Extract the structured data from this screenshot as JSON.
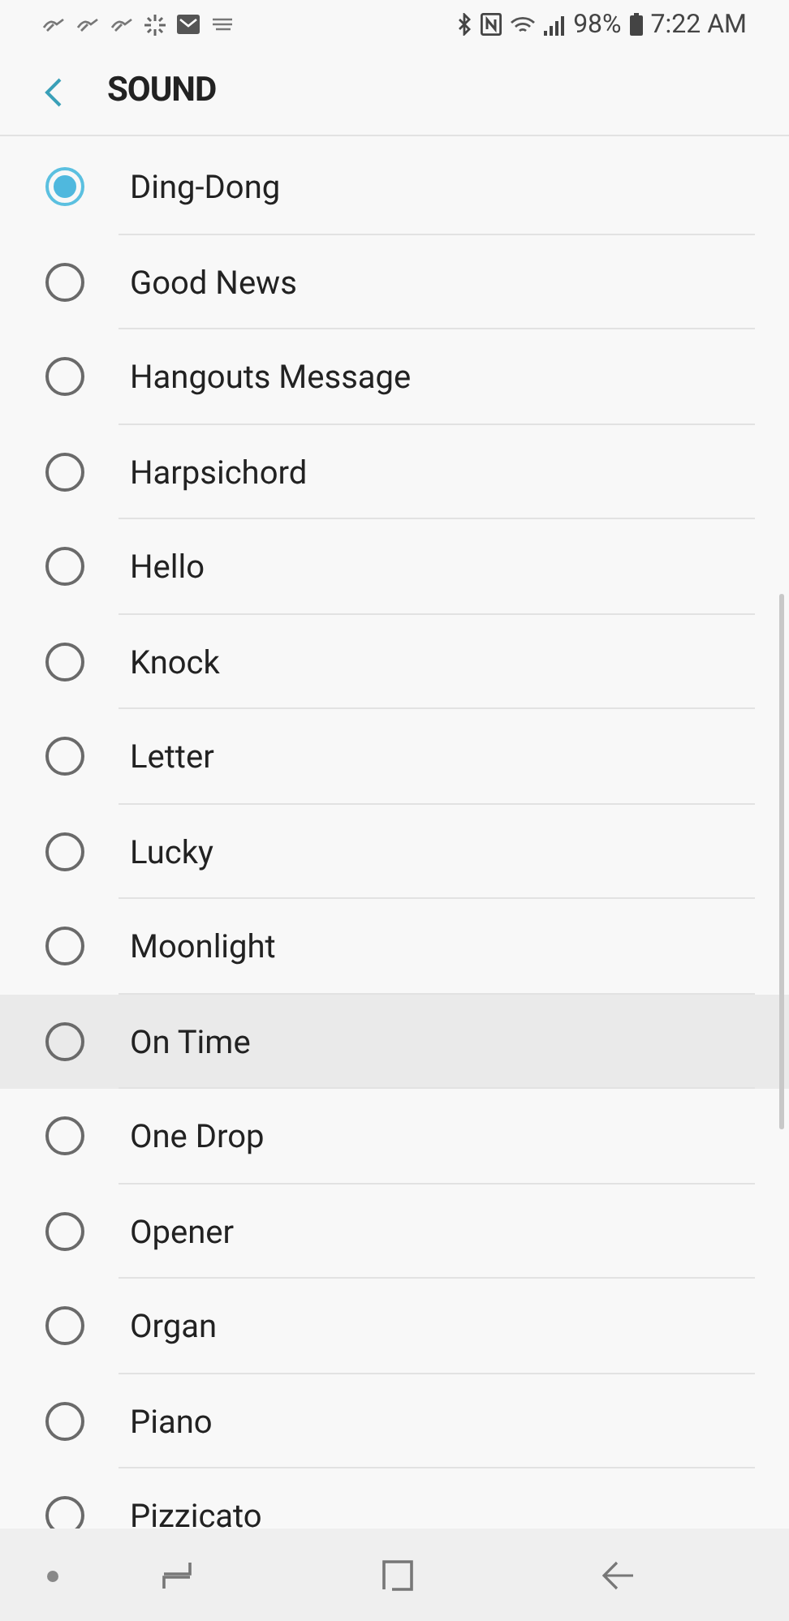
{
  "status_bar": {
    "battery": "98%",
    "time": "7:22 AM"
  },
  "header": {
    "title": "SOUND"
  },
  "sounds": [
    {
      "label": "Ding-Dong",
      "selected": true,
      "pressed": false
    },
    {
      "label": "Good News",
      "selected": false,
      "pressed": false
    },
    {
      "label": "Hangouts Message",
      "selected": false,
      "pressed": false
    },
    {
      "label": "Harpsichord",
      "selected": false,
      "pressed": false
    },
    {
      "label": "Hello",
      "selected": false,
      "pressed": false
    },
    {
      "label": "Knock",
      "selected": false,
      "pressed": false
    },
    {
      "label": "Letter",
      "selected": false,
      "pressed": false
    },
    {
      "label": "Lucky",
      "selected": false,
      "pressed": false
    },
    {
      "label": "Moonlight",
      "selected": false,
      "pressed": false
    },
    {
      "label": "On Time",
      "selected": false,
      "pressed": true
    },
    {
      "label": "One Drop",
      "selected": false,
      "pressed": false
    },
    {
      "label": "Opener",
      "selected": false,
      "pressed": false
    },
    {
      "label": "Organ",
      "selected": false,
      "pressed": false
    },
    {
      "label": "Piano",
      "selected": false,
      "pressed": false
    },
    {
      "label": "Pizzicato",
      "selected": false,
      "pressed": false
    }
  ]
}
